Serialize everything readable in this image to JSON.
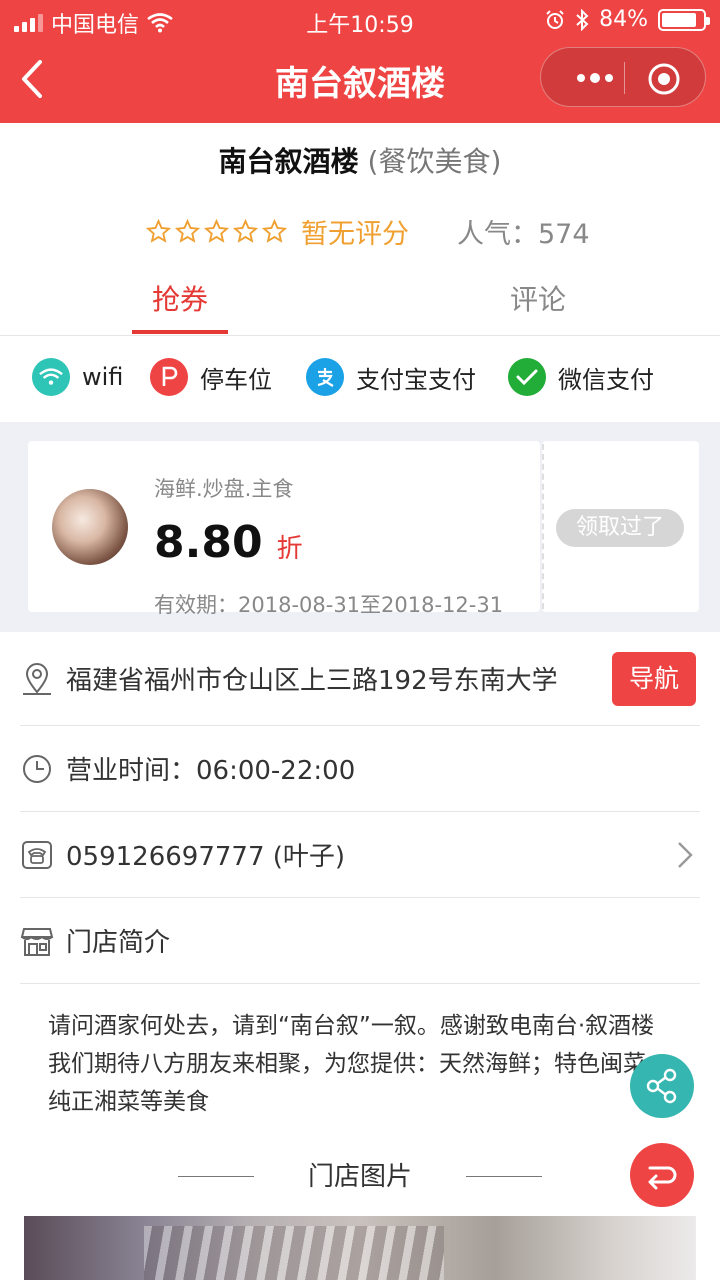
{
  "status_bar": {
    "carrier": "中国电信",
    "time": "上午10:59",
    "battery": "84%",
    "battery_level": 0.84
  },
  "nav": {
    "title": "南台叙酒楼"
  },
  "shop": {
    "name": "南台叙酒楼",
    "category": "(餐饮美食)",
    "rating_text": "暂无评分",
    "popularity_label": "人气：",
    "popularity_value": "574",
    "stars_filled": 0,
    "stars_total": 5
  },
  "tabs": [
    {
      "label": "抢券",
      "active": true
    },
    {
      "label": "评论",
      "active": false
    }
  ],
  "features": [
    {
      "label": "wifi",
      "icon": "wifi-icon",
      "color": "#2ec4b6"
    },
    {
      "label": "停车位",
      "icon": "parking-icon",
      "color": "#ef4444"
    },
    {
      "label": "支付宝支付",
      "icon": "alipay-icon",
      "color": "#1aa1e6"
    },
    {
      "label": "微信支付",
      "icon": "wechat-pay-icon",
      "color": "#22ac38"
    }
  ],
  "coupon": {
    "tags": "海鲜.炒盘.主食",
    "discount": "8.80",
    "unit": "折",
    "validity": "有效期：2018-08-31至2018-12-31",
    "status_button": "领取过了"
  },
  "info": {
    "address": "福建省福州市仓山区上三路192号东南大学",
    "nav_button": "导航",
    "hours": "营业时间：06:00-22:00",
    "phone": "059126697777 (叶子)",
    "intro_title": "门店简介"
  },
  "description": " 请问酒家何处去，请到“南台叙”一叙。感谢致电南台·叙酒楼 我们期待八方朋友来相聚，为您提供：天然海鲜；特色闽菜；纯正湘菜等美食",
  "photos_title": "门店图片",
  "colors": {
    "brand_red": "#ef4444",
    "rating_orange": "#f0a030",
    "share_teal": "#35b6b0"
  }
}
